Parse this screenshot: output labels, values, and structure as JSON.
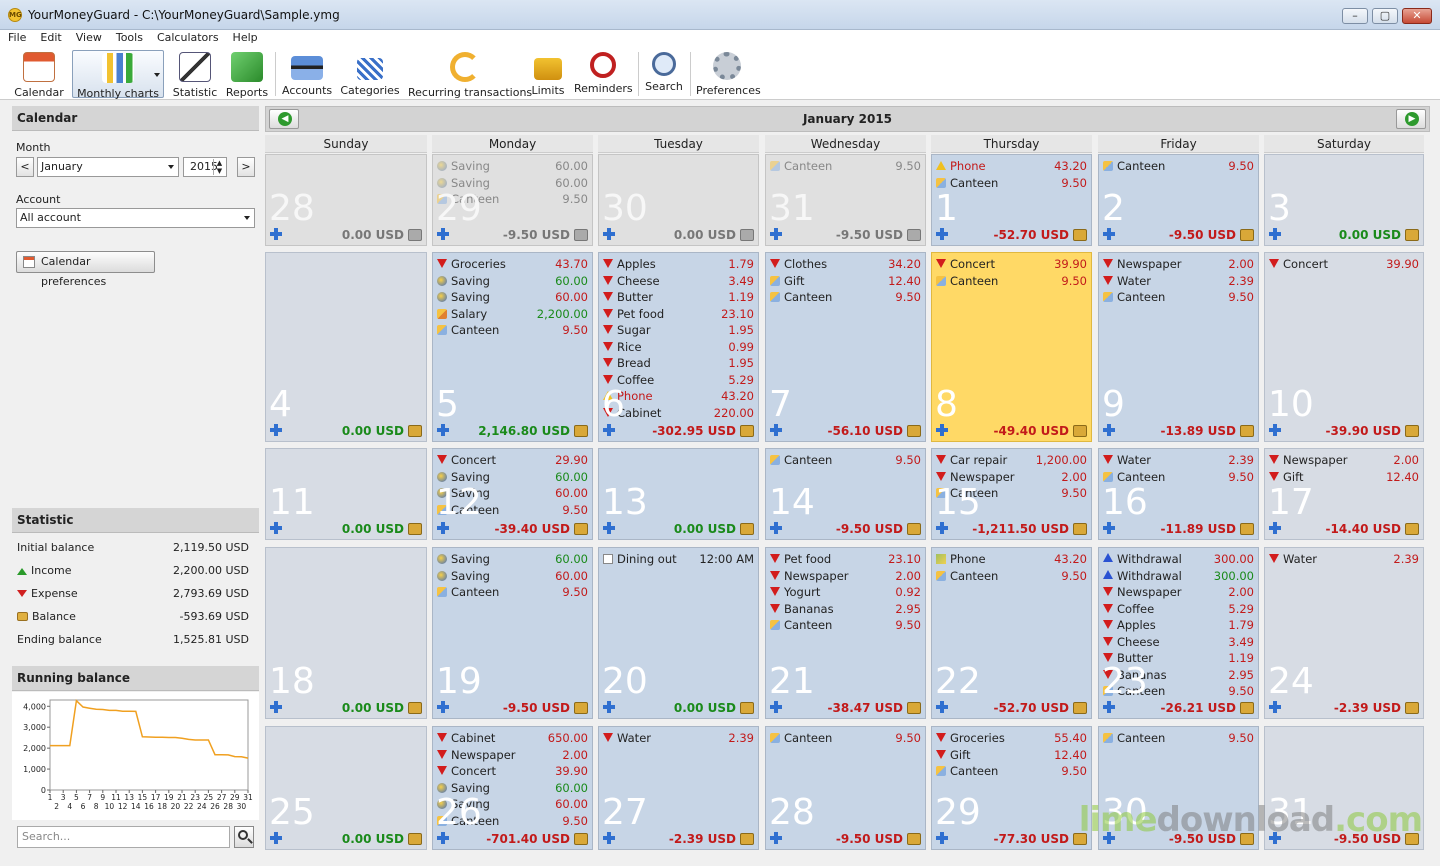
{
  "window": {
    "title": "YourMoneyGuard - C:\\YourMoneyGuard\\Sample.ymg",
    "app_icon": "money-guard-icon"
  },
  "menu": [
    "File",
    "Edit",
    "View",
    "Tools",
    "Calculators",
    "Help"
  ],
  "toolbar": {
    "calendar": "Calendar",
    "monthly_charts": "Monthly charts",
    "statistic": "Statistic",
    "reports": "Reports",
    "accounts": "Accounts",
    "categories": "Categories",
    "recurring": "Recurring transactions",
    "limits": "Limits",
    "reminders": "Reminders",
    "search": "Search",
    "preferences": "Preferences"
  },
  "left": {
    "calendar_title": "Calendar",
    "month_label": "Month",
    "month_value": "January",
    "year_value": "2015",
    "account_label": "Account",
    "account_value": "All account",
    "cal_prefs_button": "Calendar preferences",
    "statistic_title": "Statistic",
    "stats": {
      "initial_label": "Initial balance",
      "initial_value": "2,119.50 USD",
      "income_label": "Income",
      "income_value": "2,200.00 USD",
      "expense_label": "Expense",
      "expense_value": "2,793.69 USD",
      "balance_label": "Balance",
      "balance_value": "-593.69 USD",
      "ending_label": "Ending balance",
      "ending_value": "1,525.81 USD"
    },
    "running_title": "Running balance",
    "search_placeholder": "Search..."
  },
  "chart_data": {
    "type": "line",
    "x": [
      1,
      2,
      3,
      4,
      5,
      6,
      7,
      8,
      9,
      10,
      11,
      12,
      13,
      14,
      15,
      16,
      17,
      18,
      19,
      20,
      21,
      22,
      23,
      24,
      25,
      26,
      27,
      28,
      29,
      30,
      31
    ],
    "values": [
      2119.5,
      2119.5,
      2119.5,
      2119.5,
      4266.3,
      3963.35,
      3907.25,
      3857.85,
      3843.96,
      3804.06,
      3804.06,
      3764.66,
      3764.66,
      3755.16,
      2543.66,
      2531.77,
      2517.37,
      2517.37,
      2507.87,
      2507.87,
      2469.4,
      2416.7,
      2390.49,
      2388.1,
      2388.1,
      1686.7,
      1684.31,
      1674.81,
      1597.51,
      1588.01,
      1525.81
    ],
    "xticks": [
      "1",
      "3",
      "5",
      "7",
      "9",
      "11",
      "13",
      "15",
      "17",
      "19",
      "21",
      "23",
      "25",
      "27",
      "29",
      "31"
    ],
    "xticks2": [
      "2",
      "4",
      "6",
      "8",
      "10",
      "12",
      "14",
      "16",
      "18",
      "20",
      "22",
      "24",
      "26",
      "28",
      "30"
    ],
    "yticks": [
      "0",
      "1,000",
      "2,000",
      "3,000",
      "4,000"
    ],
    "ylim": [
      0,
      4300
    ],
    "color": "#f0a020"
  },
  "calendar": {
    "title": "January 2015",
    "weekdays": [
      "Sunday",
      "Monday",
      "Tuesday",
      "Wednesday",
      "Thursday",
      "Friday",
      "Saturday"
    ],
    "weeks": [
      [
        {
          "day": "28",
          "out": true,
          "total": "0.00 USD",
          "tx": []
        },
        {
          "day": "29",
          "out": true,
          "total": "-9.50 USD",
          "tx": [
            [
              "sv",
              "Saving",
              "60.00",
              "p"
            ],
            [
              "sv",
              "Saving",
              "60.00",
              "p"
            ],
            [
              "ct",
              "Canteen",
              "9.50",
              "n"
            ]
          ]
        },
        {
          "day": "30",
          "out": true,
          "total": "0.00 USD",
          "tx": []
        },
        {
          "day": "31",
          "out": true,
          "total": "-9.50 USD",
          "tx": [
            [
              "ct",
              "Canteen",
              "9.50",
              "n"
            ]
          ]
        },
        {
          "day": "1",
          "total": "-52.70 USD",
          "tx": [
            [
              "wr",
              "Phone",
              "43.20",
              "n"
            ],
            [
              "ct",
              "Canteen",
              "9.50",
              "n"
            ]
          ]
        },
        {
          "day": "2",
          "total": "-9.50 USD",
          "tx": [
            [
              "ct",
              "Canteen",
              "9.50",
              "n"
            ]
          ]
        },
        {
          "day": "3",
          "total": "0.00 USD",
          "tx": []
        }
      ],
      [
        {
          "day": "4",
          "total": "0.00 USD",
          "tx": []
        },
        {
          "day": "5",
          "total": "2,146.80 USD",
          "tx": [
            [
              "dn",
              "Groceries",
              "43.70",
              "n"
            ],
            [
              "sv",
              "Saving",
              "60.00",
              "p"
            ],
            [
              "sv",
              "Saving",
              "60.00",
              "n"
            ],
            [
              "sl",
              "Salary",
              "2,200.00",
              "p"
            ],
            [
              "ct",
              "Canteen",
              "9.50",
              "n"
            ]
          ]
        },
        {
          "day": "6",
          "total": "-302.95 USD",
          "tx": [
            [
              "dn",
              "Apples",
              "1.79",
              "n"
            ],
            [
              "dn",
              "Cheese",
              "3.49",
              "n"
            ],
            [
              "dn",
              "Butter",
              "1.19",
              "n"
            ],
            [
              "dn",
              "Pet food",
              "23.10",
              "n"
            ],
            [
              "dn",
              "Sugar",
              "1.95",
              "n"
            ],
            [
              "dn",
              "Rice",
              "0.99",
              "n"
            ],
            [
              "dn",
              "Bread",
              "1.95",
              "n"
            ],
            [
              "dn",
              "Coffee",
              "5.29",
              "n"
            ],
            [
              "wr",
              "Phone",
              "43.20",
              "n"
            ],
            [
              "dn",
              "Cabinet",
              "220.00",
              "n"
            ]
          ]
        },
        {
          "day": "7",
          "total": "-56.10 USD",
          "tx": [
            [
              "dn",
              "Clothes",
              "34.20",
              "n"
            ],
            [
              "ct",
              "Gift",
              "12.40",
              "n"
            ],
            [
              "ct",
              "Canteen",
              "9.50",
              "n"
            ]
          ]
        },
        {
          "day": "8",
          "today": true,
          "total": "-49.40 USD",
          "tx": [
            [
              "dn",
              "Concert",
              "39.90",
              "n"
            ],
            [
              "ct",
              "Canteen",
              "9.50",
              "n"
            ]
          ]
        },
        {
          "day": "9",
          "total": "-13.89 USD",
          "tx": [
            [
              "dn",
              "Newspaper",
              "2.00",
              "n"
            ],
            [
              "dn",
              "Water",
              "2.39",
              "n"
            ],
            [
              "ct",
              "Canteen",
              "9.50",
              "n"
            ]
          ]
        },
        {
          "day": "10",
          "total": "-39.90 USD",
          "tx": [
            [
              "dn",
              "Concert",
              "39.90",
              "n"
            ]
          ]
        }
      ],
      [
        {
          "day": "11",
          "total": "0.00 USD",
          "tx": []
        },
        {
          "day": "12",
          "total": "-39.40 USD",
          "tx": [
            [
              "dn",
              "Concert",
              "29.90",
              "n"
            ],
            [
              "sv",
              "Saving",
              "60.00",
              "p"
            ],
            [
              "sv",
              "Saving",
              "60.00",
              "n"
            ],
            [
              "ct",
              "Canteen",
              "9.50",
              "n"
            ]
          ]
        },
        {
          "day": "13",
          "total": "0.00 USD",
          "tx": []
        },
        {
          "day": "14",
          "total": "-9.50 USD",
          "tx": [
            [
              "ct",
              "Canteen",
              "9.50",
              "n"
            ]
          ]
        },
        {
          "day": "15",
          "total": "-1,211.50 USD",
          "tx": [
            [
              "dn",
              "Car repair",
              "1,200.00",
              "n"
            ],
            [
              "dn",
              "Newspaper",
              "2.00",
              "n"
            ],
            [
              "ct",
              "Canteen",
              "9.50",
              "n"
            ]
          ]
        },
        {
          "day": "16",
          "total": "-11.89 USD",
          "tx": [
            [
              "dn",
              "Water",
              "2.39",
              "n"
            ],
            [
              "ct",
              "Canteen",
              "9.50",
              "n"
            ]
          ]
        },
        {
          "day": "17",
          "total": "-14.40 USD",
          "tx": [
            [
              "dn",
              "Newspaper",
              "2.00",
              "n"
            ],
            [
              "dn",
              "Gift",
              "12.40",
              "n"
            ]
          ]
        }
      ],
      [
        {
          "day": "18",
          "total": "0.00 USD",
          "tx": []
        },
        {
          "day": "19",
          "total": "-9.50 USD",
          "tx": [
            [
              "sv",
              "Saving",
              "60.00",
              "p"
            ],
            [
              "sv",
              "Saving",
              "60.00",
              "n"
            ],
            [
              "ct",
              "Canteen",
              "9.50",
              "n"
            ]
          ]
        },
        {
          "day": "20",
          "total": "0.00 USD",
          "tx": [
            [
              "dc",
              "Dining out",
              "12:00 AM",
              "k"
            ]
          ]
        },
        {
          "day": "21",
          "total": "-38.47 USD",
          "tx": [
            [
              "dn",
              "Pet food",
              "23.10",
              "n"
            ],
            [
              "dn",
              "Newspaper",
              "2.00",
              "n"
            ],
            [
              "dn",
              "Yogurt",
              "0.92",
              "n"
            ],
            [
              "dn",
              "Bananas",
              "2.95",
              "n"
            ],
            [
              "ct",
              "Canteen",
              "9.50",
              "n"
            ]
          ]
        },
        {
          "day": "22",
          "total": "-52.70 USD",
          "tx": [
            [
              "ph",
              "Phone",
              "43.20",
              "n"
            ],
            [
              "ct",
              "Canteen",
              "9.50",
              "n"
            ]
          ]
        },
        {
          "day": "23",
          "total": "-26.21 USD",
          "tx": [
            [
              "up",
              "Withdrawal",
              "300.00",
              "n"
            ],
            [
              "up",
              "Withdrawal",
              "300.00",
              "p"
            ],
            [
              "dn",
              "Newspaper",
              "2.00",
              "n"
            ],
            [
              "dn",
              "Coffee",
              "5.29",
              "n"
            ],
            [
              "dn",
              "Apples",
              "1.79",
              "n"
            ],
            [
              "dn",
              "Cheese",
              "3.49",
              "n"
            ],
            [
              "dn",
              "Butter",
              "1.19",
              "n"
            ],
            [
              "dn",
              "Bananas",
              "2.95",
              "n"
            ],
            [
              "ct",
              "Canteen",
              "9.50",
              "n"
            ]
          ]
        },
        {
          "day": "24",
          "total": "-2.39 USD",
          "tx": [
            [
              "dn",
              "Water",
              "2.39",
              "n"
            ]
          ]
        }
      ],
      [
        {
          "day": "25",
          "total": "0.00 USD",
          "tx": []
        },
        {
          "day": "26",
          "total": "-701.40 USD",
          "tx": [
            [
              "dn",
              "Cabinet",
              "650.00",
              "n"
            ],
            [
              "dn",
              "Newspaper",
              "2.00",
              "n"
            ],
            [
              "dn",
              "Concert",
              "39.90",
              "n"
            ],
            [
              "sv",
              "Saving",
              "60.00",
              "p"
            ],
            [
              "sv",
              "Saving",
              "60.00",
              "n"
            ],
            [
              "ct",
              "Canteen",
              "9.50",
              "n"
            ]
          ]
        },
        {
          "day": "27",
          "total": "-2.39 USD",
          "tx": [
            [
              "dn",
              "Water",
              "2.39",
              "n"
            ]
          ]
        },
        {
          "day": "28",
          "total": "-9.50 USD",
          "tx": [
            [
              "ct",
              "Canteen",
              "9.50",
              "n"
            ]
          ]
        },
        {
          "day": "29",
          "total": "-77.30 USD",
          "tx": [
            [
              "dn",
              "Groceries",
              "55.40",
              "n"
            ],
            [
              "dn",
              "Gift",
              "12.40",
              "n"
            ],
            [
              "ct",
              "Canteen",
              "9.50",
              "n"
            ]
          ]
        },
        {
          "day": "30",
          "total": "-9.50 USD",
          "tx": [
            [
              "ct",
              "Canteen",
              "9.50",
              "n"
            ]
          ]
        },
        {
          "day": "31",
          "total": "-9.50 USD",
          "tx": []
        }
      ]
    ]
  },
  "watermark": {
    "lime": "lime",
    "rest": "download",
    "dot": ".com"
  }
}
